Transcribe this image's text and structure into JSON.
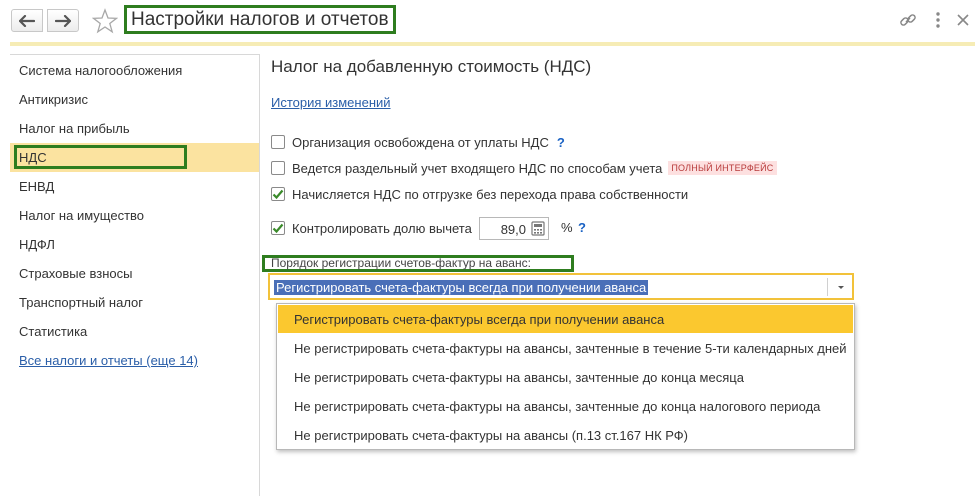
{
  "window": {
    "title": "Настройки налогов и отчетов"
  },
  "sidebar": {
    "items": [
      {
        "label": "Система налогообложения"
      },
      {
        "label": "Антикризис"
      },
      {
        "label": "Налог на прибыль"
      },
      {
        "label": "НДС"
      },
      {
        "label": "ЕНВД"
      },
      {
        "label": "Налог на имущество"
      },
      {
        "label": "НДФЛ"
      },
      {
        "label": "Страховые взносы"
      },
      {
        "label": "Транспортный налог"
      },
      {
        "label": "Статистика"
      }
    ],
    "all_taxes_link": "Все налоги и отчеты (еще 14)",
    "active_index": 3
  },
  "main": {
    "heading": "Налог на добавленную стоимость (НДС)",
    "history_link": "История изменений",
    "checkboxes": [
      {
        "label": "Организация освобождена от уплаты НДС",
        "checked": false,
        "help": "?"
      },
      {
        "label": "Ведется раздельный учет входящего НДС по способам учета",
        "checked": false,
        "badge": "ПОЛНЫЙ ИНТЕРФЕЙС"
      },
      {
        "label": "Начисляется НДС по отгрузке без перехода права собственности",
        "checked": true
      },
      {
        "label": "Контролировать долю вычета",
        "checked": true
      }
    ],
    "deduction_share": {
      "value": "89,0",
      "unit": "%",
      "help": "?"
    },
    "invoice_order": {
      "label": "Порядок регистрации счетов-фактур на аванс:",
      "selected": "Регистрировать счета-фактуры всегда при получении аванса",
      "options": [
        "Регистрировать счета-фактуры всегда при получении аванса",
        "Не регистрировать счета-фактуры на авансы, зачтенные в течение 5-ти календарных дней",
        "Не регистрировать счета-фактуры на авансы, зачтенные до конца месяца",
        "Не регистрировать счета-фактуры на авансы, зачтенные до конца налогового периода",
        "Не регистрировать счета-фактуры на авансы (п.13 ст.167 НК РФ)"
      ]
    }
  },
  "colors": {
    "highlight_border": "#2e7d1f",
    "active_sidebar": "#fbe3a0",
    "dropdown_selected": "#fbc82f",
    "field_focus_border": "#f2c23a",
    "link": "#2a5ea8",
    "help": "#1a62c4",
    "checkmark": "#3a8a2a"
  },
  "icons": {
    "back": "arrow-left-icon",
    "forward": "arrow-right-icon",
    "favorite": "star-icon",
    "link": "link-icon",
    "more": "more-vertical-icon",
    "close": "close-icon",
    "calculator": "calculator-icon",
    "dropdown": "chevron-down-icon"
  }
}
